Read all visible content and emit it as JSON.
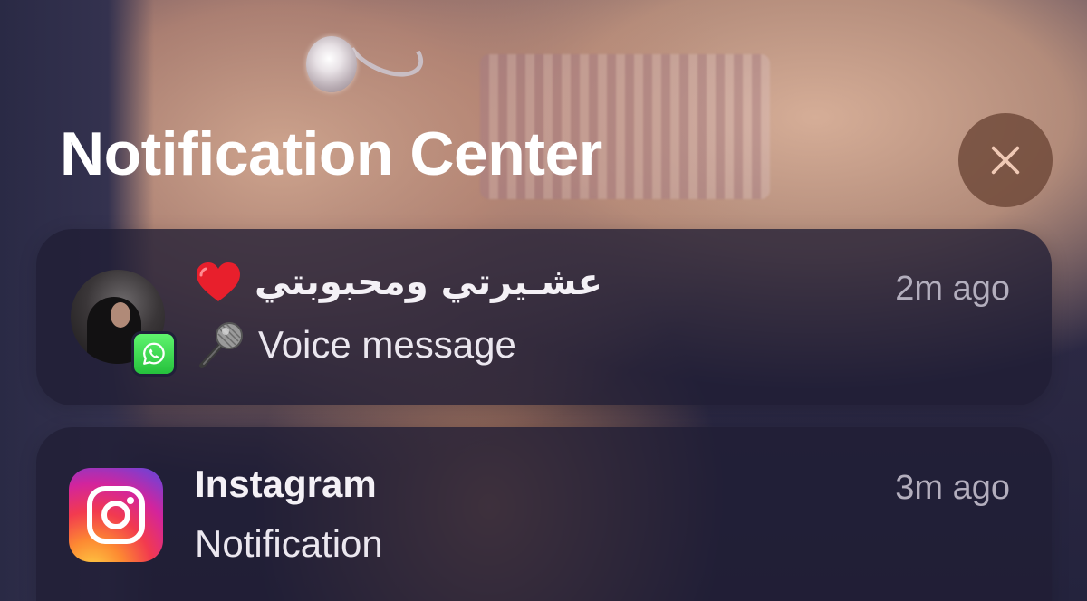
{
  "header": {
    "title": "Notification Center"
  },
  "close_button": {
    "icon": "close-icon"
  },
  "notifications": [
    {
      "app": "WhatsApp",
      "app_icon": "whatsapp-icon",
      "sender": "عشـيرتي ومحبوبتي",
      "sender_emoji": "heart-icon",
      "time": "2m ago",
      "body_emoji": "microphone-icon",
      "body": "Voice message"
    },
    {
      "app": "Instagram",
      "app_icon": "instagram-icon",
      "time": "3m ago",
      "body": "Notification"
    }
  ],
  "colors": {
    "card_bg": "#201e34",
    "close_bg": "#6e4838",
    "whatsapp_green": "#25c13c",
    "heart_red": "#e81f2c",
    "text_primary": "#f4f1f6",
    "text_secondary": "#b3aebd"
  }
}
